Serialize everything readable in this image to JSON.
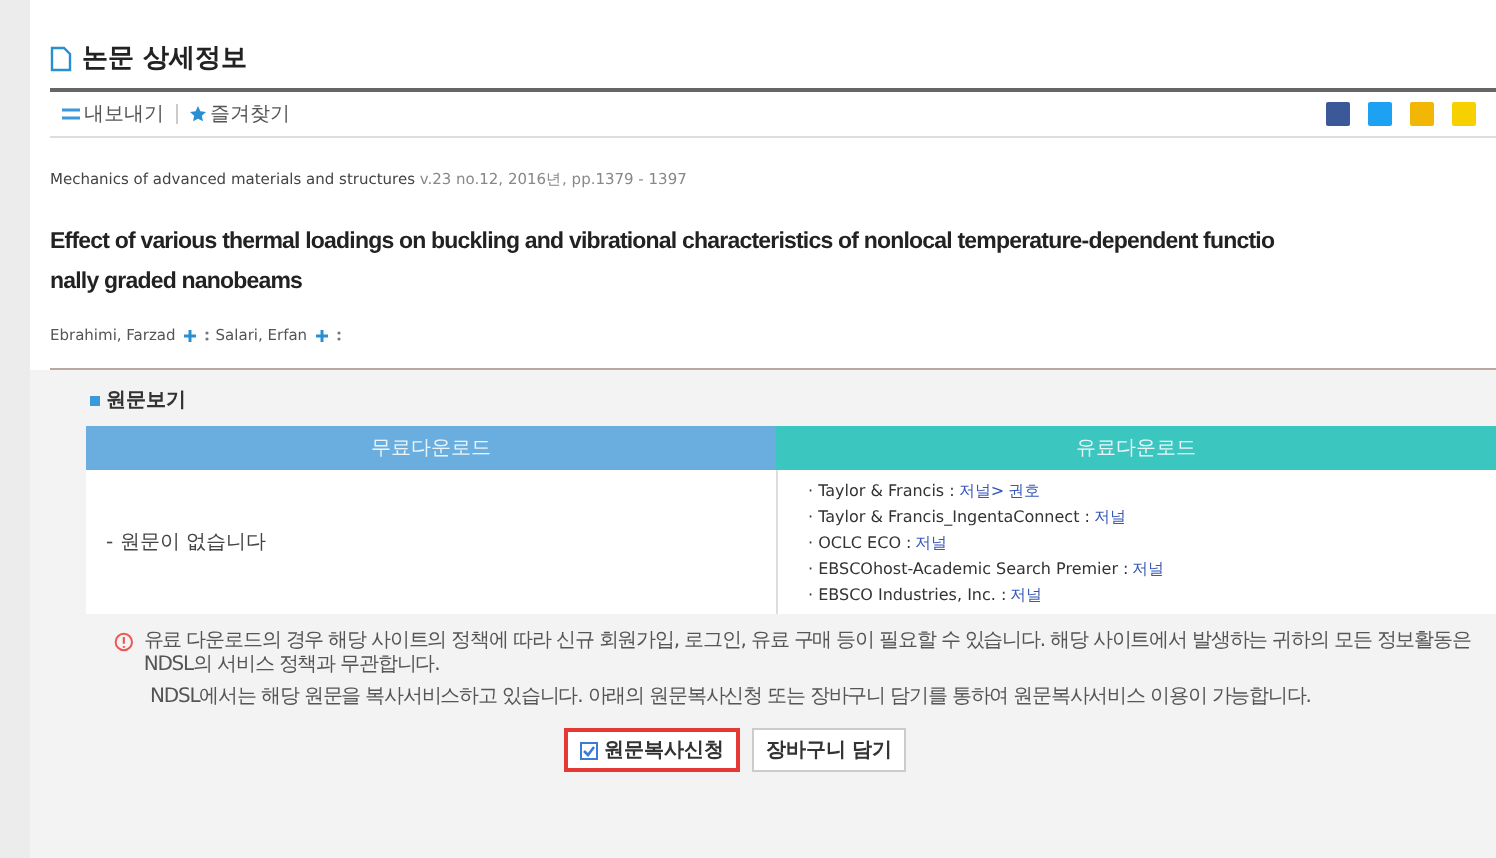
{
  "page_title": "논문 상세정보",
  "toolbar": [
    {
      "kind": "export",
      "label": "내보내기"
    },
    {
      "kind": "favorite",
      "label": "즐겨찾기"
    }
  ],
  "share": [
    {
      "kind": "facebook"
    },
    {
      "kind": "twitter"
    },
    {
      "kind": "blog"
    },
    {
      "kind": "chat"
    }
  ],
  "source": {
    "journal": "Mechanics of advanced materials and structures",
    "details": "v.23 no.12, 2016년, pp.1379 - 1397"
  },
  "title_lines": [
    "Effect of various thermal loadings on buckling and vibrational characteristics of nonlocal temperature-dependent functio",
    "nally graded nanobeams"
  ],
  "authors": [
    {
      "name": "Ebrahimi, Farzad"
    },
    {
      "name": "Salari, Erfan"
    }
  ],
  "fulltext": {
    "heading": "원문보기",
    "columns": [
      {
        "label": "무료다운로드",
        "color": "#6aaee0"
      },
      {
        "label": "유료다운로드",
        "color": "#3cc6c0"
      }
    ],
    "free_text": "- 원문이 없습니다",
    "providers": [
      {
        "name": "· Taylor & Francis : ",
        "links": [
          "저널>",
          "권호"
        ]
      },
      {
        "name": "· Taylor & Francis_IngentaConnect : ",
        "links": [
          "저널"
        ]
      },
      {
        "name": "· OCLC ECO : ",
        "links": [
          "저널"
        ]
      },
      {
        "name": "· EBSCOhost-Academic Search Premier : ",
        "links": [
          "저널"
        ]
      },
      {
        "name": "· EBSCO Industries, Inc. : ",
        "links": [
          "저널"
        ]
      }
    ],
    "notices": [
      "유료 다운로드의 경우 해당 사이트의 정책에 따라 신규 회원가입, 로그인, 유료 구매 등이 필요할 수 있습니다. 해당 사이트에서 발생하는 귀하의 모든 정보활동은 NDSL의 서비스 정책과 무관합니다.",
      "NDSL에서는 해당 원문을 복사서비스하고 있습니다. 아래의 원문복사신청 또는 장바구니 담기를 통하여 원문복사서비스 이용이 가능합니다."
    ],
    "buttons": [
      {
        "label": "원문복사신청",
        "selected": true
      },
      {
        "label": "장바구니 담기",
        "selected": false
      }
    ]
  }
}
